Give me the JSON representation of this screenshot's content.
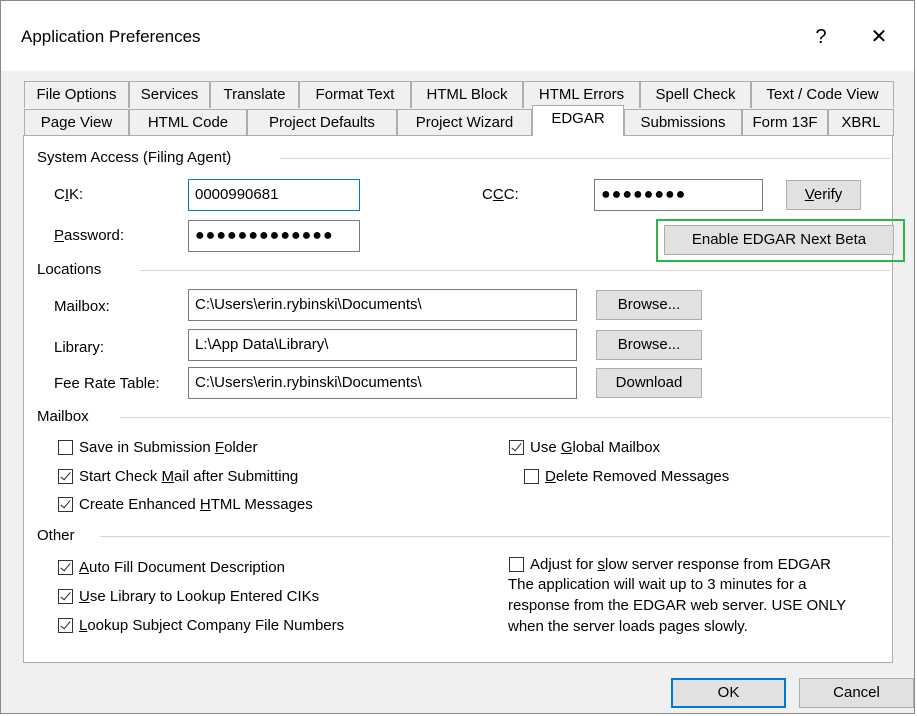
{
  "window": {
    "title": "Application Preferences",
    "help_label": "?",
    "close_label": "✕"
  },
  "tabs": {
    "row1": [
      "File Options",
      "Services",
      "Translate",
      "Format Text",
      "HTML Block",
      "HTML Errors",
      "Spell Check",
      "Text / Code View"
    ],
    "row2": [
      "Page View",
      "HTML Code",
      "Project Defaults",
      "Project Wizard",
      "EDGAR",
      "Submissions",
      "Form 13F",
      "XBRL"
    ],
    "active": "EDGAR"
  },
  "system_access": {
    "group_label": "System Access (Filing Agent)",
    "cik_label": "CIK:",
    "cik_value": "0000990681",
    "password_label": "Password:",
    "password_value": "●●●●●●●●●●●●●",
    "ccc_label": "CCC:",
    "ccc_value": "●●●●●●●●",
    "verify_label": "Verify",
    "enable_next_label": "Enable EDGAR Next Beta"
  },
  "locations": {
    "group_label": "Locations",
    "mailbox_label": "Mailbox:",
    "mailbox_value": "C:\\Users\\erin.rybinski\\Documents\\",
    "library_label": "Library:",
    "library_value": "L:\\App Data\\Library\\",
    "fee_label": "Fee Rate Table:",
    "fee_value": "C:\\Users\\erin.rybinski\\Documents\\",
    "browse_label": "Browse...",
    "download_label": "Download"
  },
  "mailbox": {
    "group_label": "Mailbox",
    "save_in_folder": {
      "label": "Save in Submission Folder",
      "checked": false
    },
    "start_check_mail": {
      "label": "Start Check Mail after Submitting",
      "checked": true
    },
    "create_enhanced": {
      "label": "Create Enhanced HTML Messages",
      "checked": true
    },
    "use_global": {
      "label": "Use Global Mailbox",
      "checked": true
    },
    "delete_removed": {
      "label": "Delete Removed Messages",
      "checked": false
    }
  },
  "other": {
    "group_label": "Other",
    "auto_fill": {
      "label": "Auto Fill Document Description",
      "checked": true
    },
    "use_library": {
      "label": "Use Library to Lookup Entered CIKs",
      "checked": true
    },
    "lookup_subject": {
      "label": "Lookup Subject Company File Numbers",
      "checked": true
    },
    "adjust_slow": {
      "label": "Adjust for slow server response from EDGAR",
      "checked": false
    },
    "slow_note": [
      "The application will wait up to 3 minutes for a",
      "response from the EDGAR web server. USE ONLY",
      "when the server loads pages slowly."
    ]
  },
  "footer": {
    "ok_label": "OK",
    "cancel_label": "Cancel"
  },
  "colors": {
    "accent": "#0078d7",
    "highlight": "#2fb44a"
  }
}
